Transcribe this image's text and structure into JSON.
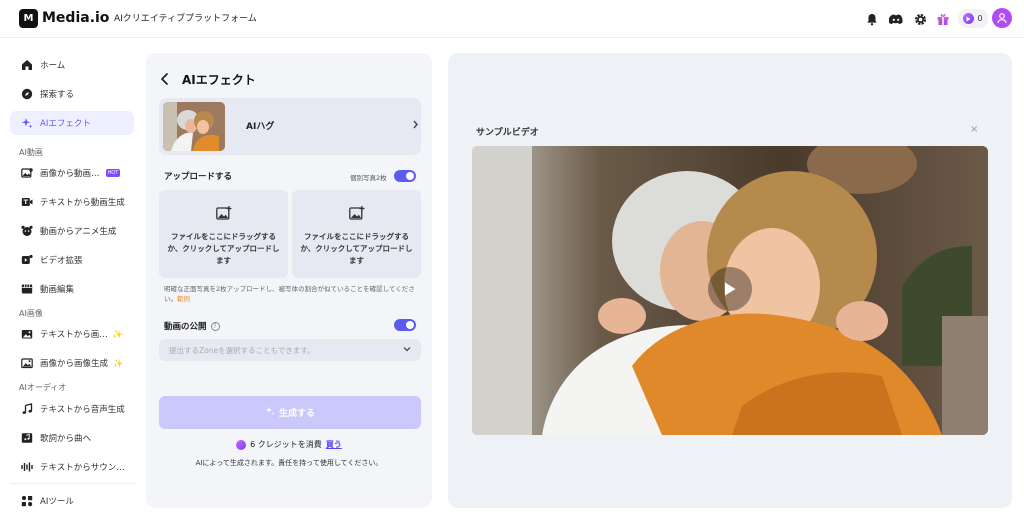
{
  "header": {
    "logo_mark": "M",
    "logo_text": "Media.io",
    "platform": "AIクリエイティブプラットフォーム",
    "credits": "0",
    "icons": [
      "bell-icon",
      "discord-icon",
      "gear-icon",
      "gift-icon"
    ]
  },
  "sidebar": {
    "items": [
      {
        "label": "ホーム",
        "icon": "home-icon"
      },
      {
        "label": "探索する",
        "icon": "compass-icon"
      },
      {
        "label": "AIエフェクト",
        "icon": "sparkle-icon"
      }
    ],
    "section_video": "AI動画",
    "video_items": [
      {
        "label": "画像から動画…",
        "badge": "HOT"
      },
      {
        "label": "テキストから動画生成"
      },
      {
        "label": "動画からアニメ生成"
      },
      {
        "label": "ビデオ拡張"
      },
      {
        "label": "動画編集"
      }
    ],
    "section_image": "AI画像",
    "image_items": [
      {
        "label": "テキストから画…"
      },
      {
        "label": "画像から画像生成"
      }
    ],
    "section_audio": "AIオーディオ",
    "audio_items": [
      {
        "label": "テキストから音声生成"
      },
      {
        "label": "歌詞から曲へ"
      },
      {
        "label": "テキストからサウン…"
      }
    ],
    "tools": "AIツール"
  },
  "left": {
    "title": "AIエフェクト",
    "effect_name": "AIハグ",
    "upload_label": "アップロードする",
    "dual_label": "個別写真2枚",
    "drop_text": "ファイルをここにドラッグするか、クリックしてアップロードします",
    "hint": "明確な正面写真を2枚アップロードし、被写体の割合が似ていることを確認してください。",
    "hint_example": "範例",
    "publish_label": "動画の公開",
    "zone_placeholder": "提出するZoneを選択することもできます。",
    "generate_label": "生成する",
    "credit_text": "6 クレジットを消費",
    "buy_label": "買う",
    "disclaimer": "AIによって生成されます。責任を持って使用してください。"
  },
  "right": {
    "sample_label": "サンプルビデオ",
    "close": "×"
  },
  "colors": {
    "accent": "#5b5bf0",
    "generate_disabled": "#cbc9fb",
    "panel_bg": "#f3f5f9"
  }
}
